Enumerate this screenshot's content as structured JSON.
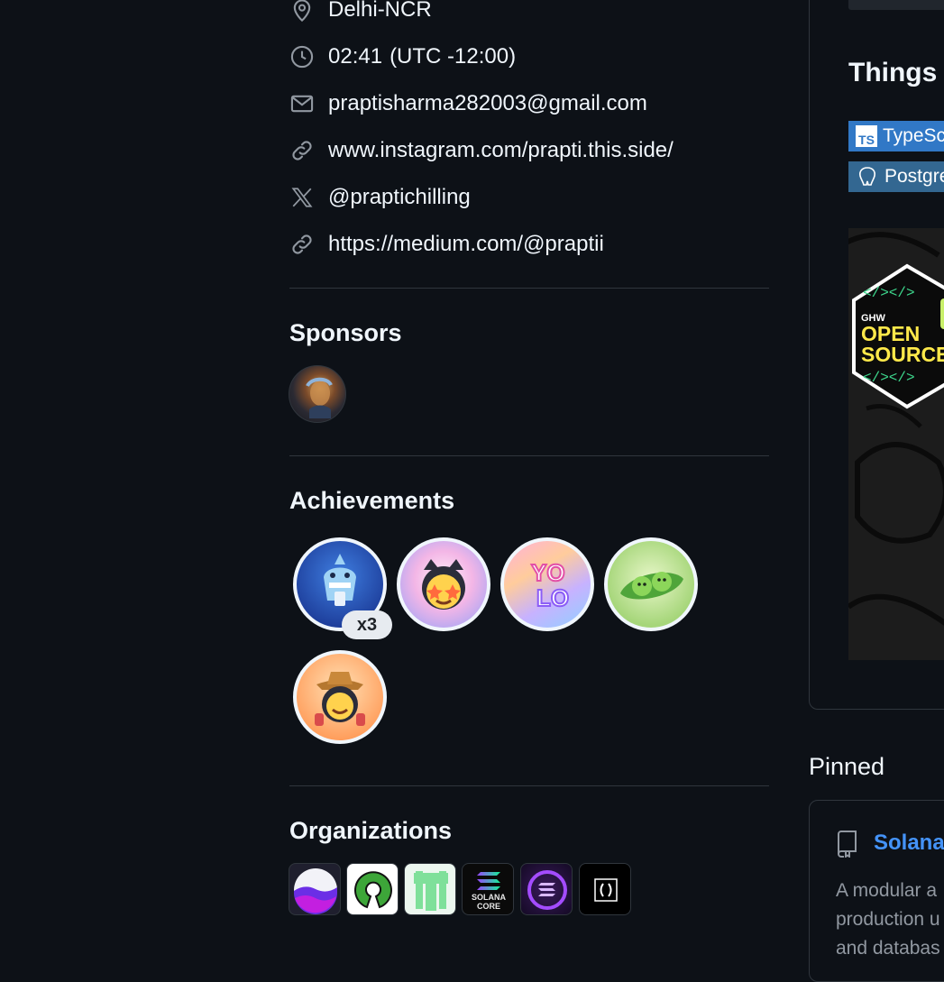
{
  "profile_info": {
    "location": "Delhi-NCR",
    "local_time": "02:41",
    "timezone": "(UTC -12:00)",
    "email": "praptisharma282003@gmail.com",
    "website": "www.instagram.com/prapti.this.side/",
    "x_handle": "@praptichilling",
    "link_2": "https://medium.com/@praptii"
  },
  "sponsors": {
    "title": "Sponsors"
  },
  "achievements": {
    "title": "Achievements",
    "count_badge": "x3"
  },
  "organizations": {
    "title": "Organizations",
    "solana_text": [
      "SOLANA",
      "CORE"
    ]
  },
  "readme": {
    "heading": "Things",
    "tech_badges": [
      "TypeSc",
      "Postgre"
    ],
    "banner_text": [
      "GHW",
      "OPEN",
      "SOURCE"
    ]
  },
  "pinned": {
    "title": "Pinned",
    "repo_name": "Solana",
    "description_lines": [
      "A modular a",
      "production u",
      "and databas"
    ]
  },
  "colors": {
    "background": "#0d1117",
    "border": "#30363d",
    "muted": "#9198a1",
    "link": "#4493f8"
  }
}
